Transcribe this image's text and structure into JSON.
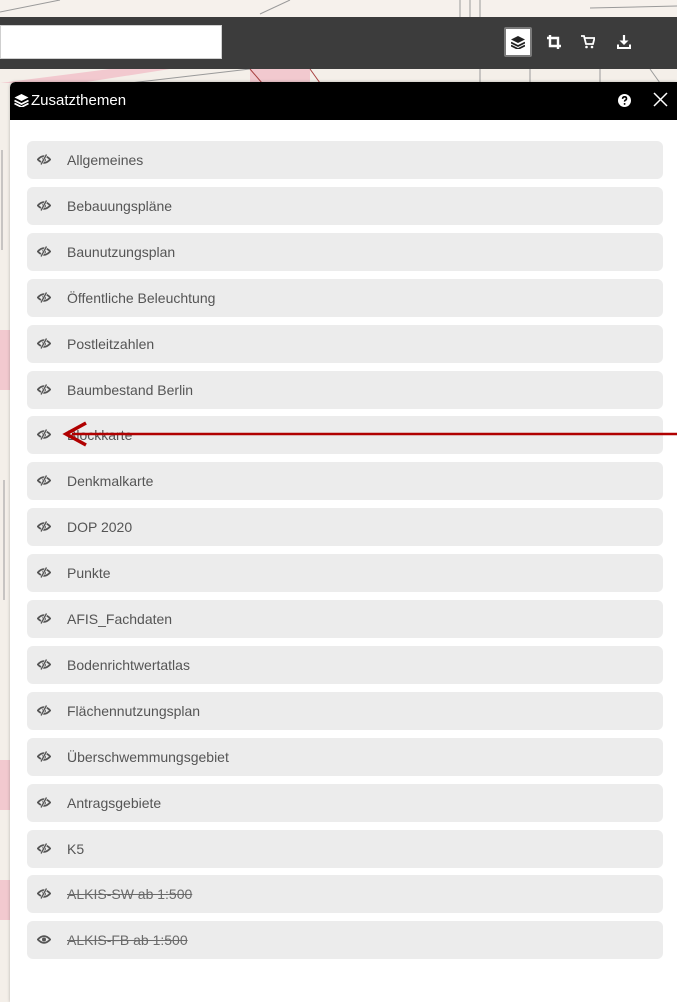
{
  "toolbar": {
    "search_value": "",
    "buttons": [
      {
        "name": "layers-button",
        "icon": "layers-icon",
        "active": true
      },
      {
        "name": "crop-button",
        "icon": "crop-icon",
        "active": false
      },
      {
        "name": "cart-button",
        "icon": "cart-icon",
        "active": false
      },
      {
        "name": "download-button",
        "icon": "download-icon",
        "active": false
      }
    ]
  },
  "panel": {
    "title": "Zusatzthemen",
    "title_icon": "layers-icon",
    "help_icon": "question-circle-icon",
    "close_icon": "close-icon"
  },
  "layers": [
    {
      "label": "Allgemeines",
      "visible": false,
      "disabled": false
    },
    {
      "label": "Bebauungspläne",
      "visible": false,
      "disabled": false
    },
    {
      "label": "Baunutzungsplan",
      "visible": false,
      "disabled": false
    },
    {
      "label": "Öffentliche Beleuchtung",
      "visible": false,
      "disabled": false
    },
    {
      "label": "Postleitzahlen",
      "visible": false,
      "disabled": false
    },
    {
      "label": "Baumbestand Berlin",
      "visible": false,
      "disabled": false
    },
    {
      "label": "Blockkarte",
      "visible": false,
      "disabled": false
    },
    {
      "label": "Denkmalkarte",
      "visible": false,
      "disabled": false
    },
    {
      "label": "DOP 2020",
      "visible": false,
      "disabled": false
    },
    {
      "label": "Punkte",
      "visible": false,
      "disabled": false
    },
    {
      "label": "AFIS_Fachdaten",
      "visible": false,
      "disabled": false
    },
    {
      "label": "Bodenrichtwertatlas",
      "visible": false,
      "disabled": false
    },
    {
      "label": "Flächennutzungsplan",
      "visible": false,
      "disabled": false
    },
    {
      "label": "Überschwemmungsgebiet",
      "visible": false,
      "disabled": false
    },
    {
      "label": "Antragsgebiete",
      "visible": false,
      "disabled": false
    },
    {
      "label": "K5",
      "visible": false,
      "disabled": false
    },
    {
      "label": "ALKIS-SW ab 1:500",
      "visible": false,
      "disabled": true
    },
    {
      "label": "ALKIS-FB ab 1:500",
      "visible": true,
      "disabled": true
    }
  ],
  "annotation": {
    "color": "#b00000"
  }
}
